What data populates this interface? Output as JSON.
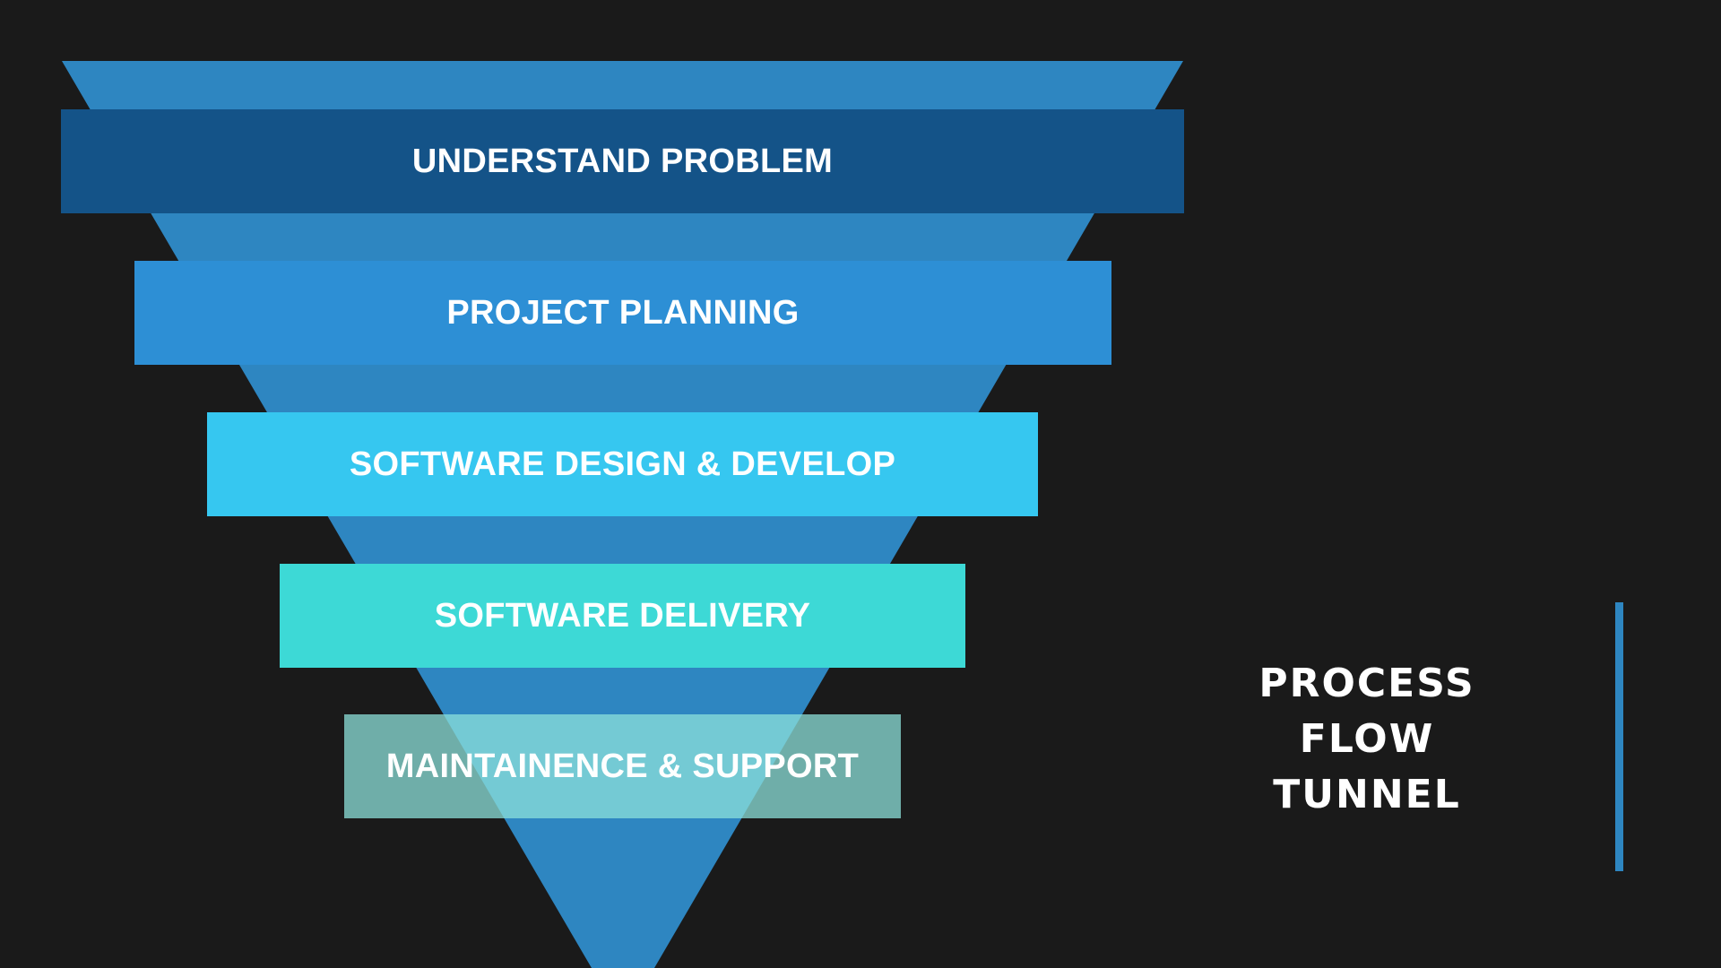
{
  "colors": {
    "background": "#1a1a1a",
    "funnel": "#2e86c1",
    "stage_1": "#145388",
    "stage_2": "#2d8fd5",
    "stage_3": "#36c7f0",
    "stage_4": "#3dd9d6",
    "stage_5": "rgba(140,224,218,0.75)",
    "accent_bar": "#2e86c1",
    "text": "#ffffff"
  },
  "funnel": {
    "stages": [
      {
        "label": "UNDERSTAND PROBLEM"
      },
      {
        "label": "PROJECT PLANNING"
      },
      {
        "label": "SOFTWARE DESIGN & DEVELOP"
      },
      {
        "label": "SOFTWARE DELIVERY"
      },
      {
        "label": "MAINTAINENCE & SUPPORT"
      }
    ]
  },
  "title": {
    "lines": [
      "PROCESS",
      "FLOW",
      "TUNNEL"
    ]
  }
}
